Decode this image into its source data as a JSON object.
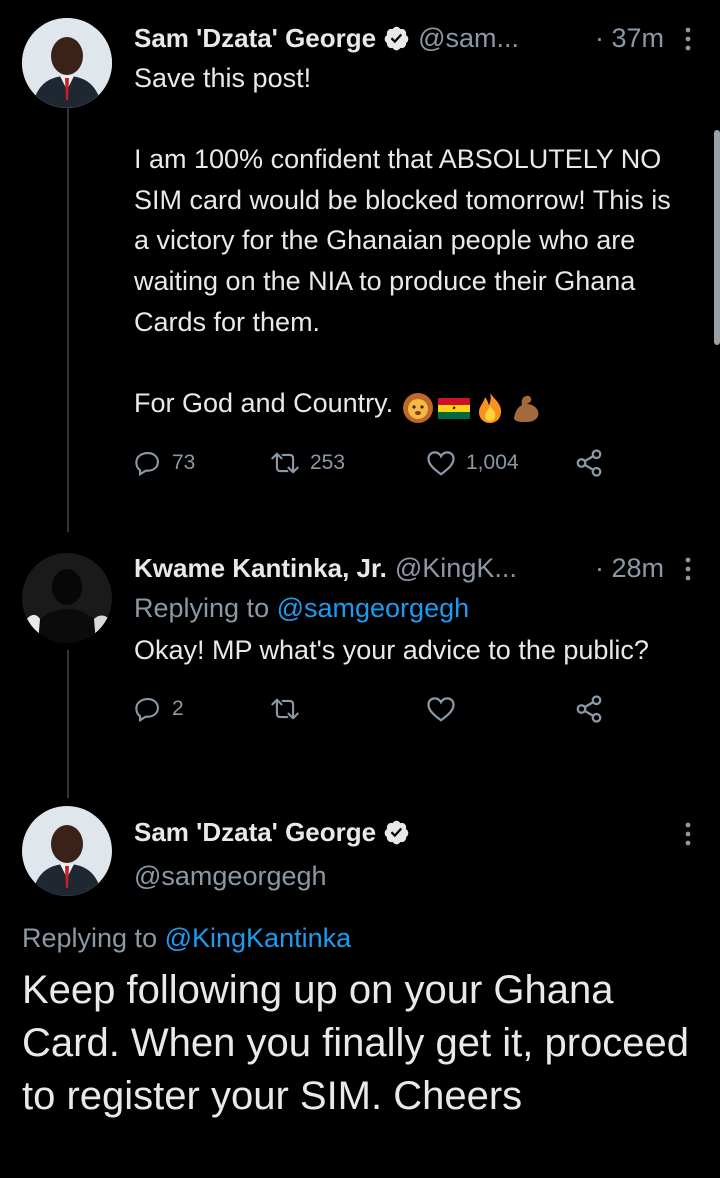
{
  "tweets": [
    {
      "name": "Sam 'Dzata' George",
      "handle": "@sam...",
      "time": "· 37m",
      "text": "Save this post!\n\nI am 100% confident that ABSOLUTELY NO SIM card would be blocked tomorrow! This is a victory for the Ghanaian people who are waiting on the NIA to produce their Ghana Cards for them.\n\n",
      "text_end": "For God and Country.",
      "emojis": [
        "lion-emoji",
        "ghana-flag-emoji",
        "fire-emoji",
        "flexed-biceps-emoji"
      ],
      "replies": "73",
      "retweets": "253",
      "likes": "1,004"
    },
    {
      "name": "Kwame Kantinka, Jr.",
      "handle": "@KingK...",
      "time": "· 28m",
      "replying_prefix": "Replying to ",
      "replying_to": "@samgeorgegh",
      "text": "Okay! MP what's your advice to the public?",
      "replies": "2",
      "retweets": "",
      "likes": ""
    }
  ],
  "focus_tweet": {
    "name": "Sam 'Dzata' George",
    "handle": "@samgeorgegh",
    "replying_prefix": "Replying to ",
    "replying_to": "@KingKantinka",
    "text": "Keep following up on your Ghana Card. When you finally get it, proceed to register your SIM. Cheers"
  },
  "colors": {
    "background": "#000000",
    "text": "#e7e9ea",
    "muted": "#8b98a5",
    "accent": "#1d9bf0"
  }
}
